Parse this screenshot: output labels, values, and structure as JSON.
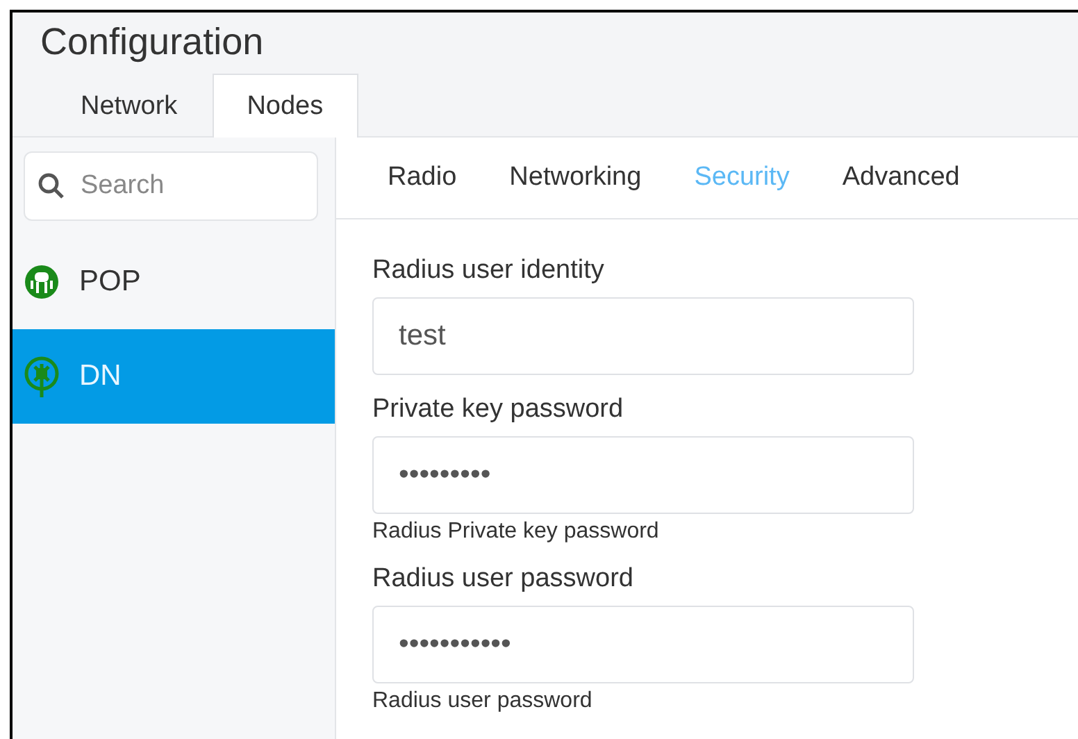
{
  "title": "Configuration",
  "tabs": [
    {
      "label": "Network",
      "selected": false
    },
    {
      "label": "Nodes",
      "selected": true
    }
  ],
  "search": {
    "placeholder": "Search"
  },
  "nodes": [
    {
      "label": "POP",
      "kind": "pop",
      "selected": false
    },
    {
      "label": "DN",
      "kind": "dn",
      "selected": true
    }
  ],
  "subtabs": [
    {
      "label": "Radio",
      "selected": false
    },
    {
      "label": "Networking",
      "selected": false
    },
    {
      "label": "Security",
      "selected": true
    },
    {
      "label": "Advanced",
      "selected": false
    }
  ],
  "fields": [
    {
      "label": "Radius user identity",
      "value": "test"
    },
    {
      "label": "Private key password",
      "value": "•••••••••",
      "help": "Radius Private key password"
    },
    {
      "label": "Radius user password",
      "value": "•••••••••••",
      "help": "Radius user password"
    }
  ]
}
